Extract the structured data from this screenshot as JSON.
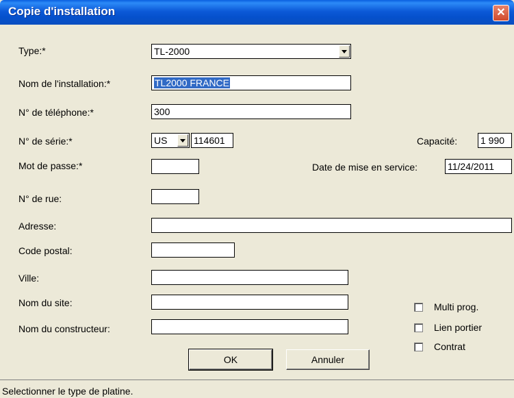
{
  "window": {
    "title": "Copie d'installation",
    "close_symbol": "✕"
  },
  "form": {
    "type": {
      "label": "Type:*",
      "value": "TL-2000"
    },
    "nom_installation": {
      "label": "Nom de l'installation:*",
      "value": "TL2000 FRANCE"
    },
    "telephone": {
      "label": "N° de téléphone:*",
      "value": "300"
    },
    "serie": {
      "label": "N° de série:*",
      "prefix": "US",
      "value": "114601"
    },
    "capacite": {
      "label": "Capacité:",
      "value": "1 990"
    },
    "mot_de_passe": {
      "label": "Mot de passe:*",
      "value": ""
    },
    "date_service": {
      "label": "Date de mise en service:",
      "value": "11/24/2011"
    },
    "rue": {
      "label": "N° de rue:",
      "value": ""
    },
    "adresse": {
      "label": "Adresse:",
      "value": ""
    },
    "code_postal": {
      "label": "Code postal:",
      "value": ""
    },
    "ville": {
      "label": "Ville:",
      "value": ""
    },
    "nom_site": {
      "label": "Nom du site:",
      "value": ""
    },
    "constructeur": {
      "label": "Nom du constructeur:",
      "value": ""
    }
  },
  "options": {
    "multi_prog": {
      "label": "Multi prog.",
      "checked": false
    },
    "lien_portier": {
      "label": "Lien portier",
      "checked": false
    },
    "contrat": {
      "label": "Contrat",
      "checked": false
    }
  },
  "buttons": {
    "ok": "OK",
    "annuler": "Annuler"
  },
  "status": {
    "text": "Selectionner le type de platine."
  },
  "colors": {
    "titlebar": "#0550cc",
    "selection": "#316ac5",
    "background": "#ece9d8"
  }
}
